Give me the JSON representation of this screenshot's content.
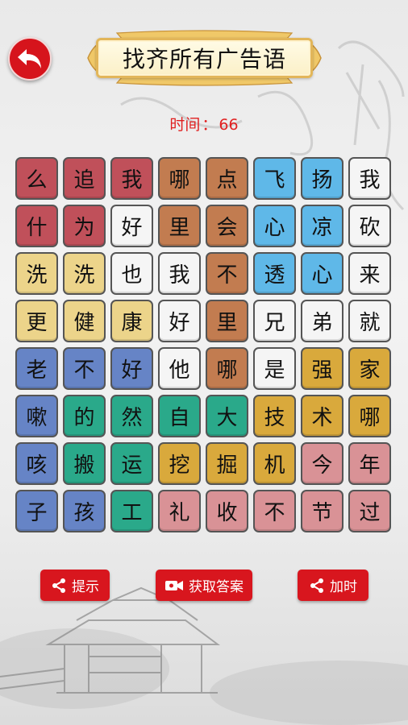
{
  "header": {
    "back_icon": "back-arrow-icon",
    "title": "找齐所有广告语"
  },
  "timer": {
    "label": "时间",
    "separator": "：",
    "value": "66"
  },
  "board": {
    "rows": [
      [
        {
          "ch": "么",
          "color": "red"
        },
        {
          "ch": "追",
          "color": "red"
        },
        {
          "ch": "我",
          "color": "red"
        },
        {
          "ch": "哪",
          "color": "brown"
        },
        {
          "ch": "点",
          "color": "brown"
        },
        {
          "ch": "飞",
          "color": "blue"
        },
        {
          "ch": "扬",
          "color": "blue"
        },
        {
          "ch": "我",
          "color": "white"
        }
      ],
      [
        {
          "ch": "什",
          "color": "red"
        },
        {
          "ch": "为",
          "color": "red"
        },
        {
          "ch": "好",
          "color": "white"
        },
        {
          "ch": "里",
          "color": "brown"
        },
        {
          "ch": "会",
          "color": "brown"
        },
        {
          "ch": "心",
          "color": "blue"
        },
        {
          "ch": "凉",
          "color": "blue"
        },
        {
          "ch": "砍",
          "color": "white"
        }
      ],
      [
        {
          "ch": "洗",
          "color": "yellow"
        },
        {
          "ch": "洗",
          "color": "yellow"
        },
        {
          "ch": "也",
          "color": "white"
        },
        {
          "ch": "我",
          "color": "white"
        },
        {
          "ch": "不",
          "color": "brown"
        },
        {
          "ch": "透",
          "color": "blue"
        },
        {
          "ch": "心",
          "color": "blue"
        },
        {
          "ch": "来",
          "color": "white"
        }
      ],
      [
        {
          "ch": "更",
          "color": "yellow"
        },
        {
          "ch": "健",
          "color": "yellow"
        },
        {
          "ch": "康",
          "color": "yellow"
        },
        {
          "ch": "好",
          "color": "white"
        },
        {
          "ch": "里",
          "color": "brown"
        },
        {
          "ch": "兄",
          "color": "white"
        },
        {
          "ch": "弟",
          "color": "white"
        },
        {
          "ch": "就",
          "color": "white"
        }
      ],
      [
        {
          "ch": "老",
          "color": "navy"
        },
        {
          "ch": "不",
          "color": "navy"
        },
        {
          "ch": "好",
          "color": "navy"
        },
        {
          "ch": "他",
          "color": "white"
        },
        {
          "ch": "哪",
          "color": "brown"
        },
        {
          "ch": "是",
          "color": "white"
        },
        {
          "ch": "强",
          "color": "gold"
        },
        {
          "ch": "家",
          "color": "gold"
        }
      ],
      [
        {
          "ch": "嗽",
          "color": "navy"
        },
        {
          "ch": "的",
          "color": "green"
        },
        {
          "ch": "然",
          "color": "green"
        },
        {
          "ch": "自",
          "color": "green"
        },
        {
          "ch": "大",
          "color": "green"
        },
        {
          "ch": "技",
          "color": "gold"
        },
        {
          "ch": "术",
          "color": "gold"
        },
        {
          "ch": "哪",
          "color": "gold"
        }
      ],
      [
        {
          "ch": "咳",
          "color": "navy"
        },
        {
          "ch": "搬",
          "color": "green"
        },
        {
          "ch": "运",
          "color": "green"
        },
        {
          "ch": "挖",
          "color": "gold"
        },
        {
          "ch": "掘",
          "color": "gold"
        },
        {
          "ch": "机",
          "color": "gold"
        },
        {
          "ch": "今",
          "color": "pink"
        },
        {
          "ch": "年",
          "color": "pink"
        }
      ],
      [
        {
          "ch": "子",
          "color": "navy"
        },
        {
          "ch": "孩",
          "color": "navy"
        },
        {
          "ch": "工",
          "color": "green"
        },
        {
          "ch": "礼",
          "color": "pink"
        },
        {
          "ch": "收",
          "color": "pink"
        },
        {
          "ch": "不",
          "color": "pink"
        },
        {
          "ch": "节",
          "color": "pink"
        },
        {
          "ch": "过",
          "color": "pink"
        }
      ]
    ]
  },
  "buttons": {
    "hint": {
      "label": "提示",
      "icon": "share-icon"
    },
    "answer": {
      "label": "获取答案",
      "icon": "video-camera-icon"
    },
    "add_time": {
      "label": "加时",
      "icon": "share-icon"
    }
  },
  "colors": {
    "accent_red": "#d8161e",
    "red": "#c0505a",
    "brown": "#c27c50",
    "blue": "#5fb8e8",
    "white": "#f5f5f5",
    "yellow": "#ecd48a",
    "navy": "#6684c6",
    "green": "#2aa98a",
    "gold": "#d9a93c",
    "pink": "#d99296"
  }
}
